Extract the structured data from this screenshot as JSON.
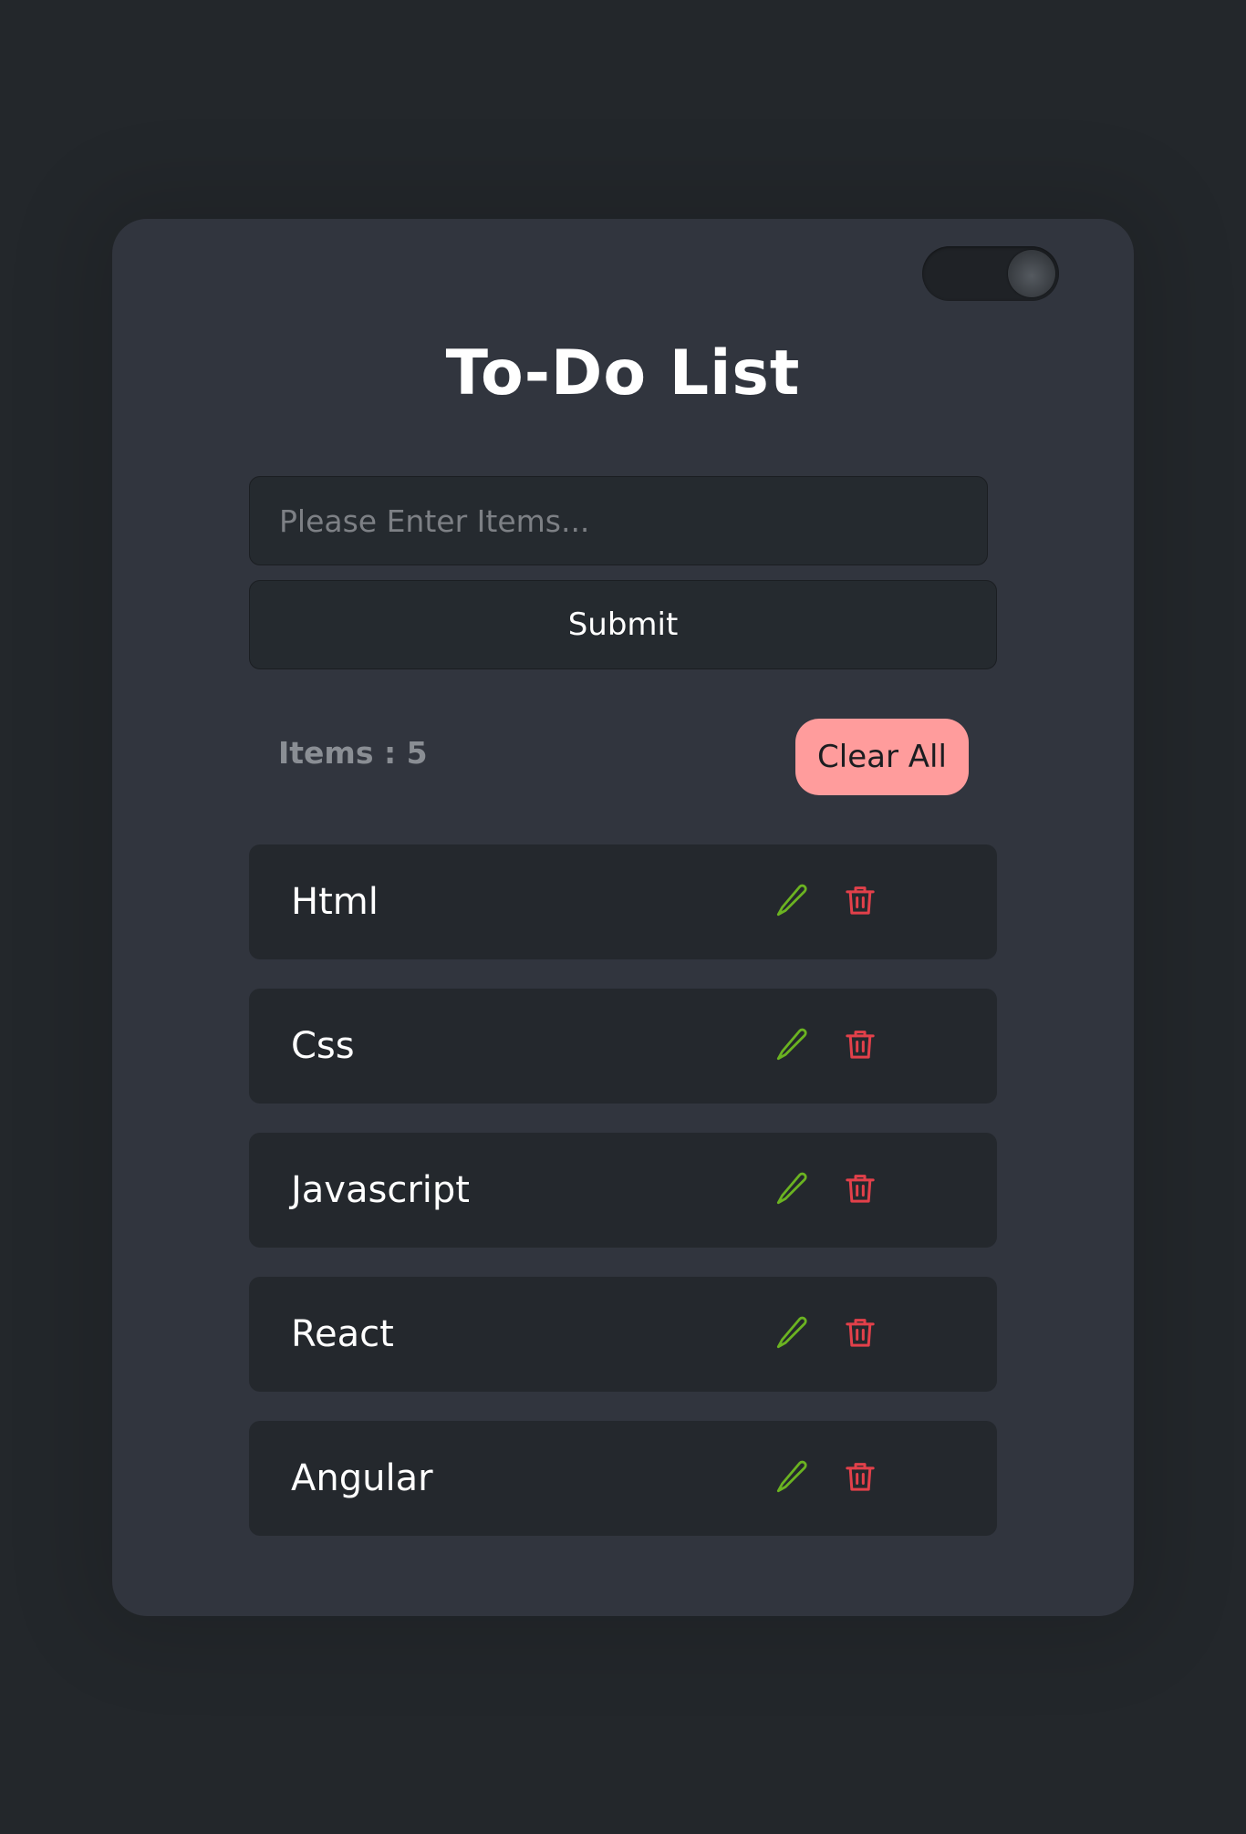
{
  "app": {
    "title": "To-Do List"
  },
  "theme_toggle": {
    "state": "on"
  },
  "form": {
    "input_placeholder": "Please Enter Items...",
    "input_value": "",
    "submit_label": "Submit"
  },
  "summary": {
    "count_label": "Items : 5",
    "clear_label": "Clear All"
  },
  "items": [
    {
      "label": "Html"
    },
    {
      "label": "Css"
    },
    {
      "label": "Javascript"
    },
    {
      "label": "React"
    },
    {
      "label": "Angular"
    }
  ],
  "colors": {
    "page_bg": "#23272b",
    "card_bg": "#31353e",
    "item_bg": "#24282d",
    "clear_button": "#ff9c9c",
    "edit_icon": "#6bb321",
    "delete_icon": "#e2404a"
  },
  "icons": {
    "edit": "pencil-icon",
    "delete": "trash-icon"
  }
}
